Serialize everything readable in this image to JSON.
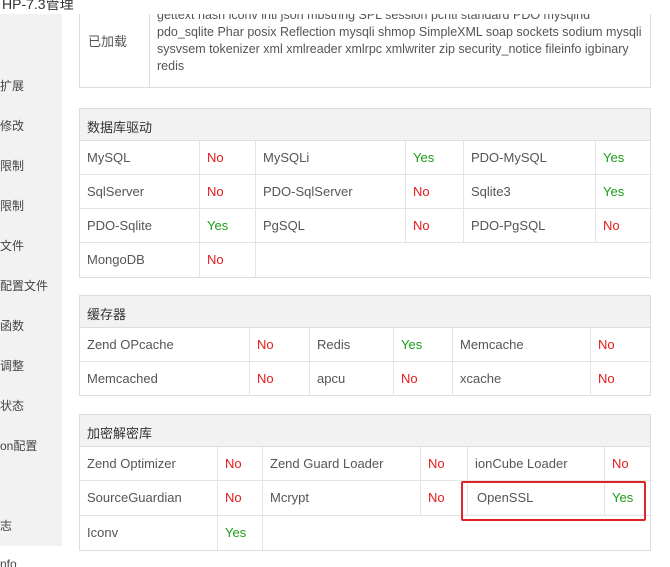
{
  "title": "HP-7.3管理",
  "sidebar": {
    "items": [
      "扩展",
      "修改",
      "限制",
      "限制",
      "文件",
      "配置文件",
      "函数",
      "调整",
      "状态",
      "on配置",
      "志",
      "nfo"
    ]
  },
  "loaded": {
    "label": "已加载",
    "text": "gettext hash iconv intl json mbstring SPL session pcntl standard PDO mysqlnd pdo_sqlite Phar posix Reflection mysqli shmop SimpleXML soap sockets sodium mysqli sysvsem tokenizer xml xmlreader xmlrpc xmlwriter zip security_notice fileinfo igbinary redis"
  },
  "colors": {
    "yes": "#1a9c1a",
    "no": "#e31b1b",
    "highlight": "#e2242a"
  },
  "db": {
    "title": "数据库驱动",
    "rows": [
      [
        [
          "MySQL",
          "No"
        ],
        [
          "MySQLi",
          "Yes"
        ],
        [
          "PDO-MySQL",
          "Yes"
        ]
      ],
      [
        [
          "SqlServer",
          "No"
        ],
        [
          "PDO-SqlServer",
          "No"
        ],
        [
          "Sqlite3",
          "Yes"
        ]
      ],
      [
        [
          "PDO-Sqlite",
          "Yes"
        ],
        [
          "PgSQL",
          "No"
        ],
        [
          "PDO-PgSQL",
          "No"
        ]
      ],
      [
        [
          "MongoDB",
          "No"
        ]
      ]
    ]
  },
  "cache": {
    "title": "缓存器",
    "rows": [
      [
        [
          "Zend OPcache",
          "No"
        ],
        [
          "Redis",
          "Yes"
        ],
        [
          "Memcache",
          "No"
        ]
      ],
      [
        [
          "Memcached",
          "No"
        ],
        [
          "apcu",
          "No"
        ],
        [
          "xcache",
          "No"
        ]
      ]
    ]
  },
  "crypto": {
    "title": "加密解密库",
    "rows": [
      [
        [
          "Zend Optimizer",
          "No"
        ],
        [
          "Zend Guard Loader",
          "No"
        ],
        [
          "ionCube Loader",
          "No"
        ]
      ],
      [
        [
          "SourceGuardian",
          "No"
        ],
        [
          "Mcrypt",
          "No"
        ],
        [
          "OpenSSL",
          "Yes"
        ]
      ],
      [
        [
          "Iconv",
          "Yes"
        ]
      ]
    ]
  }
}
